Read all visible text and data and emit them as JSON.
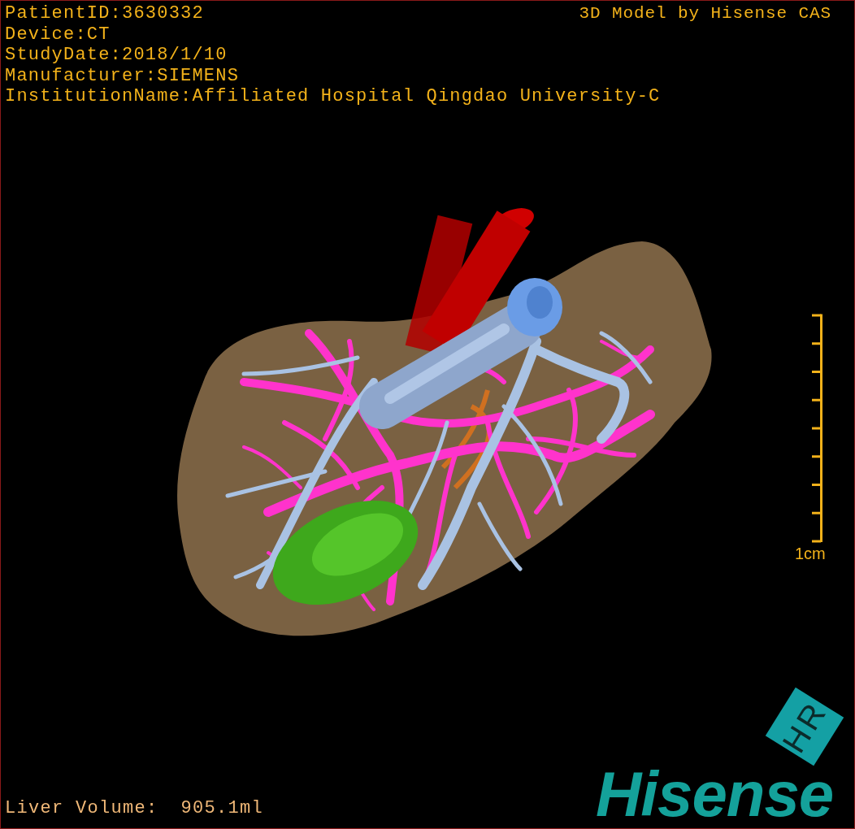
{
  "viewport": {
    "info_lines": [
      "PatientID:3630332",
      "Device:CT",
      "StudyDate:2018/1/10",
      "Manufacturer:SIEMENS",
      "InstitutionName:Affiliated Hospital Qingdao University-C"
    ],
    "title_overlay": "3D Model by Hisense CAS",
    "scale": {
      "label": "1cm"
    },
    "measurement": {
      "label": "Liver Volume:",
      "value": "905.1ml"
    },
    "logo": {
      "badge": "HR",
      "wordmark": "Hisense"
    }
  }
}
